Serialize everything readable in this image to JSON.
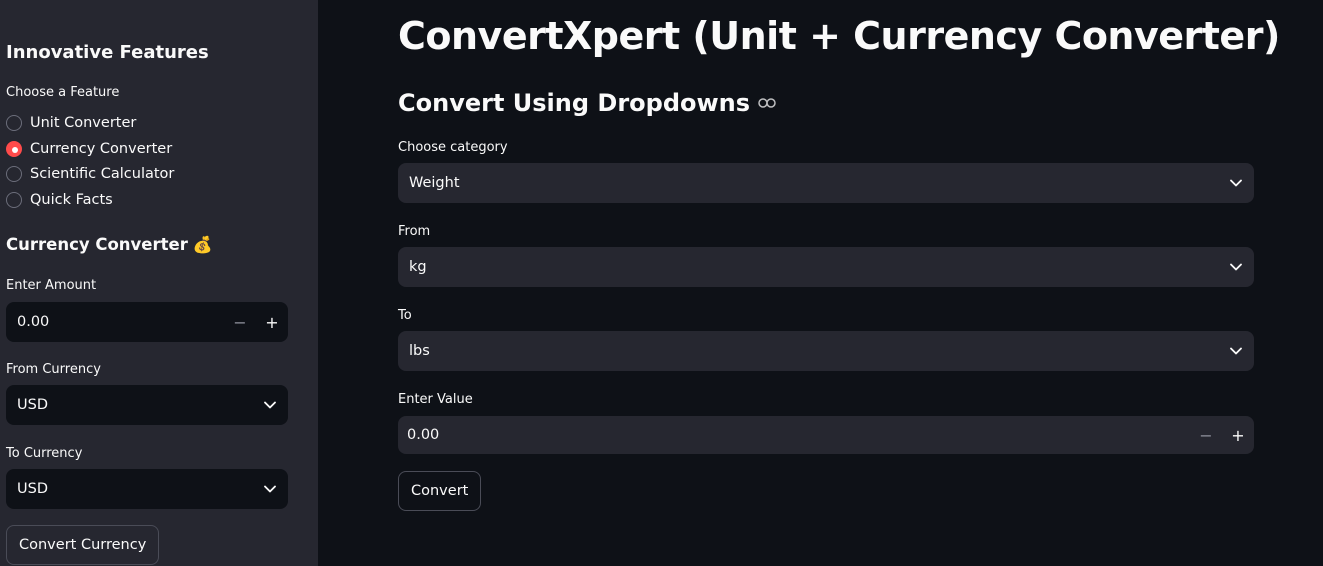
{
  "sidebar": {
    "heading": "Innovative Features",
    "feature_label": "Choose a Feature",
    "features": [
      {
        "label": "Unit Converter",
        "selected": false
      },
      {
        "label": "Currency Converter",
        "selected": true
      },
      {
        "label": "Scientific Calculator",
        "selected": false
      },
      {
        "label": "Quick Facts",
        "selected": false
      }
    ],
    "currency_heading": "Currency Converter",
    "currency_icon": "💰",
    "amount_label": "Enter Amount",
    "amount_value": "0.00",
    "from_label": "From Currency",
    "from_value": "USD",
    "to_label": "To Currency",
    "to_value": "USD",
    "convert_button": "Convert Currency"
  },
  "main": {
    "title": "ConvertXpert (Unit + Currency Converter)",
    "subtitle": "Convert Using Dropdowns",
    "category_label": "Choose category",
    "category_value": "Weight",
    "from_label": "From",
    "from_value": "kg",
    "to_label": "To",
    "to_value": "lbs",
    "value_label": "Enter Value",
    "value_value": "0.00",
    "convert_button": "Convert"
  },
  "colors": {
    "accent": "#ff4b4b",
    "background": "#0e1117",
    "sidebar_bg": "#262730"
  }
}
